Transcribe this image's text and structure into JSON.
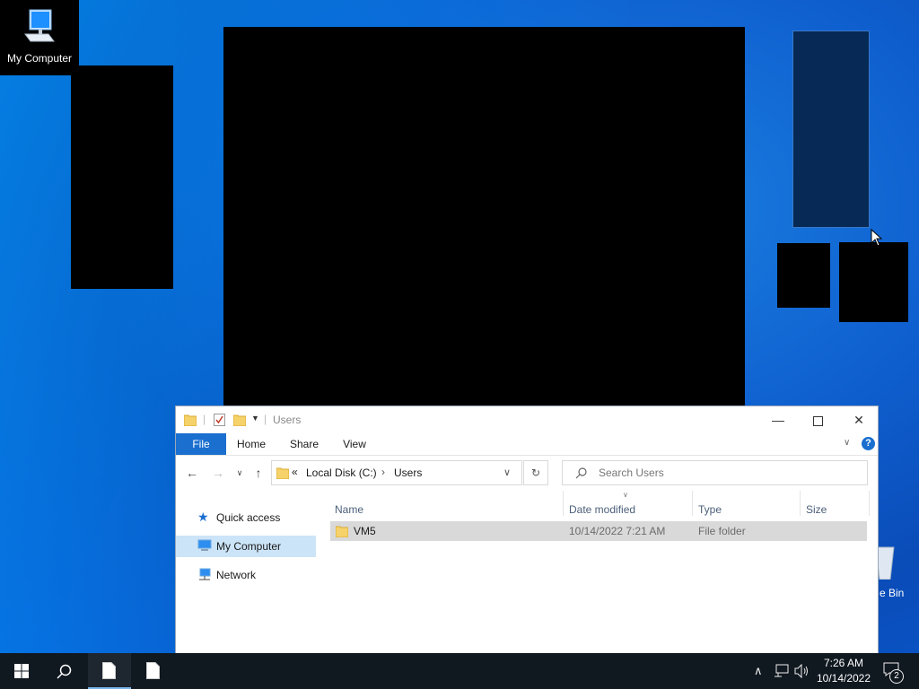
{
  "desktop": {
    "icons": [
      {
        "label": "My Computer"
      },
      {
        "label": "e Bin"
      }
    ]
  },
  "explorer": {
    "title": "Users",
    "ribbon_tabs": [
      "File",
      "Home",
      "Share",
      "View"
    ],
    "address": {
      "prefix": "«",
      "crumbs": [
        "Local Disk (C:)",
        "Users"
      ]
    },
    "search_placeholder": "Search Users",
    "nav_pane": [
      {
        "label": "Quick access",
        "icon": "star-icon"
      },
      {
        "label": "My Computer",
        "icon": "computer-icon",
        "selected": true
      },
      {
        "label": "Network",
        "icon": "network-icon"
      }
    ],
    "columns": [
      "Name",
      "Date modified",
      "Type",
      "Size"
    ],
    "rows": [
      {
        "name": "VM5",
        "date": "10/14/2022 7:21 AM",
        "type": "File folder",
        "size": ""
      }
    ]
  },
  "taskbar": {
    "time": "7:26 AM",
    "date": "10/14/2022",
    "notifications": "2"
  }
}
